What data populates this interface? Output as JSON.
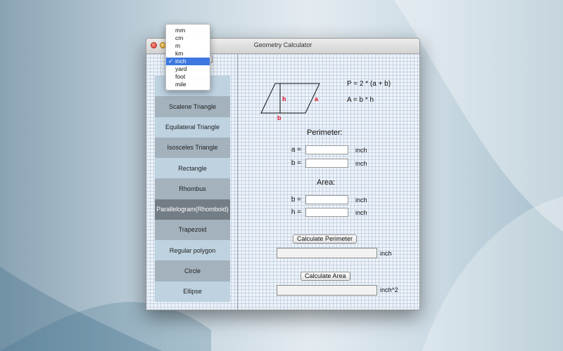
{
  "window": {
    "title": "Geometry Calculator"
  },
  "unit_menu": {
    "options": [
      "mm",
      "cm",
      "m",
      "km",
      "inch",
      "yard",
      "foot",
      "mile"
    ],
    "selected_index": 4,
    "check_glyph": "✓"
  },
  "sidebar": {
    "items": [
      {
        "label": ""
      },
      {
        "label": "Scalene Triangle"
      },
      {
        "label": "Equilateral Triangle"
      },
      {
        "label": "Isosceles Triangle"
      },
      {
        "label": "Rectangle"
      },
      {
        "label": "Rhombus"
      },
      {
        "label": "Parallelogram(Rhomboid)"
      },
      {
        "label": "Trapezoid"
      },
      {
        "label": "Regular polygon"
      },
      {
        "label": "Circle"
      },
      {
        "label": "Ellipse"
      }
    ],
    "selected_index": 6
  },
  "diagram": {
    "label_h": "h",
    "label_a": "a",
    "label_b": "b",
    "accent": "#e0102a"
  },
  "formulas": {
    "perimeter": "P = 2 * (a + b)",
    "area": "A = b * h"
  },
  "perimeter": {
    "title": "Perimeter:",
    "a_label": "a =",
    "a_value": "",
    "a_unit": "inch",
    "b_label": "b =",
    "b_value": "",
    "b_unit": "inch"
  },
  "area": {
    "title": "Area:",
    "b_label": "b =",
    "b_value": "",
    "b_unit": "inch",
    "h_label": "h =",
    "h_value": "",
    "h_unit": "inch"
  },
  "actions": {
    "calc_perimeter": "Calculate Perimeter",
    "perimeter_result": "",
    "perimeter_unit": "inch",
    "calc_area": "Calculate Area",
    "area_result": "",
    "area_unit": "inch^2"
  }
}
